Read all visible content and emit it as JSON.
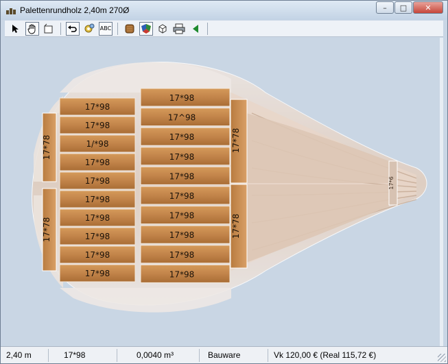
{
  "window": {
    "title": "Palettenrundholz 2,40m 270Ø"
  },
  "window_controls": {
    "minimize": "–",
    "maximize": "□",
    "close": "✕"
  },
  "toolbar": {
    "select": "select-arrow-icon",
    "pan": "hand-pan-icon",
    "crop": "crop-icon",
    "undo": "undo-icon",
    "settings": "gear-settings-icon",
    "abc": "ABC",
    "wood": "wood-block-icon",
    "color": "color-shield-icon",
    "box3d": "cube-3d-icon",
    "print": "printer-icon",
    "back": "green-back-arrow-icon"
  },
  "boards": {
    "left": [
      "17*98",
      "17*98",
      "1/*98",
      "17*98",
      "17*98",
      "17*98",
      "17*98",
      "17*98",
      "17*98",
      "17*98"
    ],
    "middle": [
      "17*98",
      "17^98",
      "17*98",
      "17*98",
      "17*98",
      "17*98",
      "17*98",
      "17*98",
      "17*98",
      "17*98"
    ],
    "side_left": [
      "17*78",
      "17*78"
    ],
    "side_right": [
      "17*78",
      "17*78"
    ],
    "tip": "17*6"
  },
  "status": {
    "length": "2,40 m",
    "profile": "17*98",
    "volume": "0,0040 m³",
    "grade": "Bauware",
    "price": "Vk 120,00 € (Real 115,72 €)"
  },
  "colors": {
    "wood": "#c8894a",
    "wood_dark": "#9a6430",
    "ghost": "#e6dfda",
    "background": "#c9d6e4"
  }
}
